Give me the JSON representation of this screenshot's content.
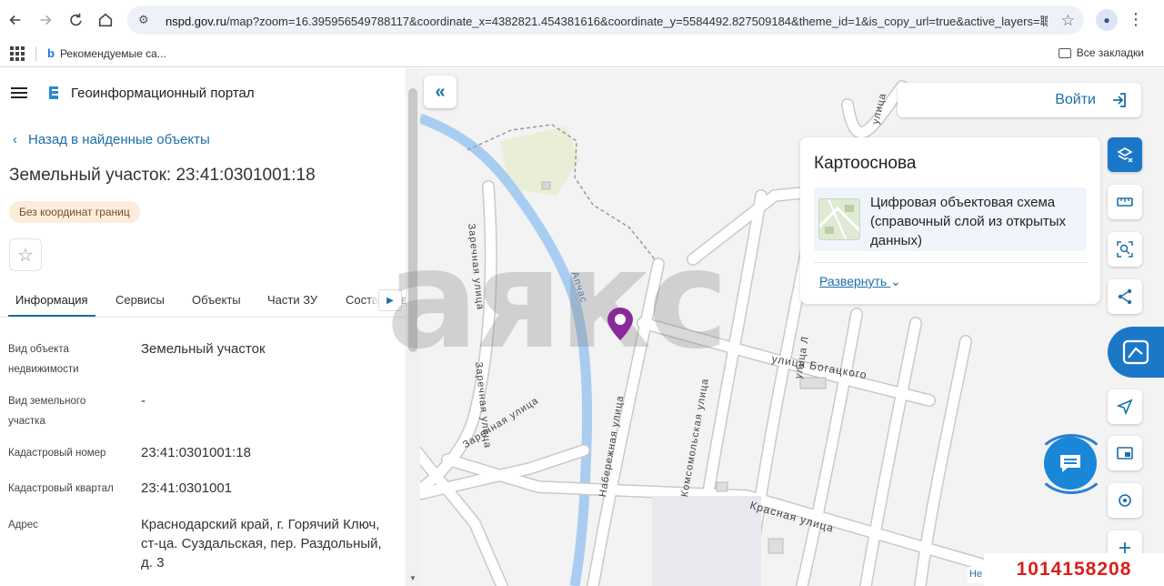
{
  "browser": {
    "url_prefix": "nspd.gov.ru",
    "url_rest": "/map?zoom=16.395956549788117&coordinate_x=4382821.454381616&coordinate_y=5584492.827509184&theme_id=1&is_copy_url=true&active_layers=聰",
    "bookmark_label": "Рекомендуемые са...",
    "all_bookmarks_label": "Все закладки"
  },
  "panel": {
    "portal_title": "Геоинформационный портал",
    "back_label": "Назад в найденные объекты",
    "object_title": "Земельный участок: 23:41:0301001:18",
    "badge": "Без координат границ",
    "tabs": [
      "Информация",
      "Сервисы",
      "Объекты",
      "Части ЗУ",
      "Соста"
    ],
    "tab_suffix": "в",
    "rows": [
      {
        "key": "Вид объекта недвижимости",
        "value": "Земельный участок"
      },
      {
        "key": "Вид земельного участка",
        "value": "-"
      },
      {
        "key": "Кадастровый номер",
        "value": "23:41:0301001:18"
      },
      {
        "key": "Кадастровый квартал",
        "value": "23:41:0301001"
      },
      {
        "key": "Адрес",
        "value": "Краснодарский край, г. Горячий Ключ, ст-ца. Суздальская, пер. Раздольный, д. 3"
      }
    ]
  },
  "map": {
    "login_label": "Войти",
    "basemap_title": "Картооснова",
    "basemap_layer": "Цифровая объектовая схема (справочный слой из открытых данных)",
    "expand_label": "Развернуть",
    "streets": {
      "zarechnaya_1": "Заречная улица",
      "zarechnaya_2": "Заречная улица",
      "zarechnaya_3": "Заречная улица",
      "river": "Апчас",
      "bogatskogo": "улица Богацкого",
      "naberezhnaya": "Набережная улица",
      "komsomolskaya": "Комсомольская улица",
      "krasnaya": "Красная улица",
      "ulitsa_l": "улица Л",
      "ulitsa_top": "улица"
    },
    "watermark": "аякс",
    "listing_id": "1014158208",
    "scale_chip": "Не"
  },
  "colors": {
    "accent": "#1b6fa8",
    "tool_active": "#1b78c8",
    "marker": "#8a2a9a",
    "river": "#a9cdf0",
    "listing_id": "#d9201c"
  }
}
